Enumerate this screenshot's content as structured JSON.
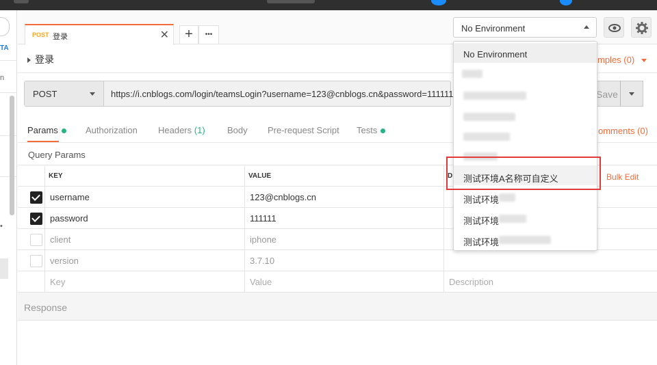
{
  "tab": {
    "method": "POST",
    "name": "登录",
    "close": "✕",
    "add": "+",
    "more": "•••"
  },
  "environment": {
    "selected": "No Environment",
    "options": [
      {
        "label": "No Environment"
      },
      {
        "label": ""
      },
      {
        "label": ""
      },
      {
        "label": ""
      },
      {
        "label": ""
      },
      {
        "label": ""
      },
      {
        "label": "测试环境A名称可自定义"
      },
      {
        "label": "测试环境"
      },
      {
        "label": "测试环境"
      },
      {
        "label": "测试环境"
      }
    ]
  },
  "sidebar": {
    "link_text": "TA",
    "partial_text": "n",
    "dot": "•"
  },
  "request": {
    "title": "登录",
    "method": "POST",
    "url": "https://i.cnblogs.com/login/teamsLogin?username=123@cnblogs.cn&password=111111",
    "save_label": "Save",
    "examples_label": "mples (0)"
  },
  "subtabs": [
    {
      "label": "Params",
      "dot": true,
      "active": true
    },
    {
      "label": "Authorization"
    },
    {
      "label": "Headers",
      "count": "(1)"
    },
    {
      "label": "Body"
    },
    {
      "label": "Pre-request Script"
    },
    {
      "label": "Tests",
      "dot": true
    }
  ],
  "comments_label": "omments (0)",
  "query_params": {
    "title": "Query Params",
    "headers": {
      "key": "KEY",
      "value": "VALUE",
      "description": "D"
    },
    "bulk_edit": "Bulk Edit",
    "rows": [
      {
        "checked": true,
        "key": "username",
        "value": "123@cnblogs.cn"
      },
      {
        "checked": true,
        "key": "password",
        "value": "111111"
      },
      {
        "checked": false,
        "key": "client",
        "value": "iphone"
      },
      {
        "checked": false,
        "key": "version",
        "value": "3.7.10"
      }
    ],
    "placeholder": {
      "key": "Key",
      "value": "Value",
      "description": "Description"
    }
  },
  "response_label": "Response",
  "colors": {
    "accent": "#f26b3a",
    "green": "#26b47f",
    "highlight": "#e03a3a"
  }
}
